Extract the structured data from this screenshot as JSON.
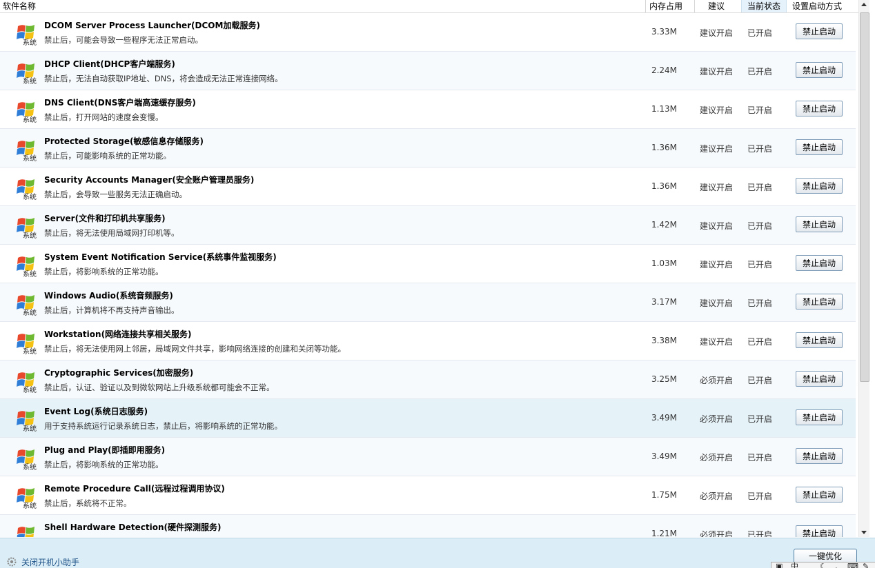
{
  "header": {
    "col_name": "软件名称",
    "col_memory": "内存占用",
    "col_recommend": "建议",
    "col_status": "当前状态",
    "col_startup": "设置启动方式"
  },
  "icon_label": "系统",
  "rows": [
    {
      "name": "DCOM Server Process Launcher(DCOM加载服务)",
      "desc": "禁止后，可能会导致一些程序无法正常启动。",
      "memory": "3.33M",
      "recommend": "建议开启",
      "status": "已开启",
      "button": "禁止启动"
    },
    {
      "name": "DHCP Client(DHCP客户端服务)",
      "desc": "禁止后，无法自动获取IP地址、DNS，将会造成无法正常连接网络。",
      "memory": "2.24M",
      "recommend": "建议开启",
      "status": "已开启",
      "button": "禁止启动"
    },
    {
      "name": "DNS Client(DNS客户端高速缓存服务)",
      "desc": "禁止后，打开网站的速度会变慢。",
      "memory": "1.13M",
      "recommend": "建议开启",
      "status": "已开启",
      "button": "禁止启动"
    },
    {
      "name": "Protected Storage(敏感信息存储服务)",
      "desc": "禁止后，可能影响系统的正常功能。",
      "memory": "1.36M",
      "recommend": "建议开启",
      "status": "已开启",
      "button": "禁止启动"
    },
    {
      "name": "Security Accounts Manager(安全账户管理员服务)",
      "desc": "禁止后，会导致一些服务无法正确启动。",
      "memory": "1.36M",
      "recommend": "建议开启",
      "status": "已开启",
      "button": "禁止启动"
    },
    {
      "name": "Server(文件和打印机共享服务)",
      "desc": "禁止后，将无法使用局域网打印机等。",
      "memory": "1.42M",
      "recommend": "建议开启",
      "status": "已开启",
      "button": "禁止启动"
    },
    {
      "name": "System Event Notification Service(系统事件监视服务)",
      "desc": "禁止后，将影响系统的正常功能。",
      "memory": "1.03M",
      "recommend": "建议开启",
      "status": "已开启",
      "button": "禁止启动"
    },
    {
      "name": "Windows Audio(系统音频服务)",
      "desc": "禁止后，计算机将不再支持声音输出。",
      "memory": "3.17M",
      "recommend": "建议开启",
      "status": "已开启",
      "button": "禁止启动"
    },
    {
      "name": "Workstation(网络连接共享相关服务)",
      "desc": "禁止后，将无法使用网上邻居，局域网文件共享，影响网络连接的创建和关闭等功能。",
      "memory": "3.38M",
      "recommend": "建议开启",
      "status": "已开启",
      "button": "禁止启动"
    },
    {
      "name": "Cryptographic Services(加密服务)",
      "desc": "禁止后，认证、验证以及到微软网站上升级系统都可能会不正常。",
      "memory": "3.25M",
      "recommend": "必须开启",
      "status": "已开启",
      "button": "禁止启动"
    },
    {
      "name": "Event Log(系统日志服务)",
      "desc": "用于支持系统运行记录系统日志，禁止后，将影响系统的正常功能。",
      "memory": "3.49M",
      "recommend": "必须开启",
      "status": "已开启",
      "button": "禁止启动"
    },
    {
      "name": "Plug and Play(即插即用服务)",
      "desc": "禁止后，将影响系统的正常功能。",
      "memory": "3.49M",
      "recommend": "必须开启",
      "status": "已开启",
      "button": "禁止启动"
    },
    {
      "name": "Remote Procedure Call(远程过程调用协议)",
      "desc": "禁止后，系统将不正常。",
      "memory": "1.75M",
      "recommend": "必须开启",
      "status": "已开启",
      "button": "禁止启动"
    },
    {
      "name": "Shell Hardware Detection(硬件探测服务)",
      "desc": "",
      "memory": "1.21M",
      "recommend": "必须开启",
      "status": "已开启",
      "button": "禁止启动"
    }
  ],
  "footer": {
    "helper_link": "关闭开机小助手",
    "optimize_button": "一键优化",
    "ime_text": "中"
  },
  "colors": {
    "row_highlight": "#e5f2f8",
    "bottom_bar": "#dbeef7",
    "link": "#1b4f86"
  }
}
